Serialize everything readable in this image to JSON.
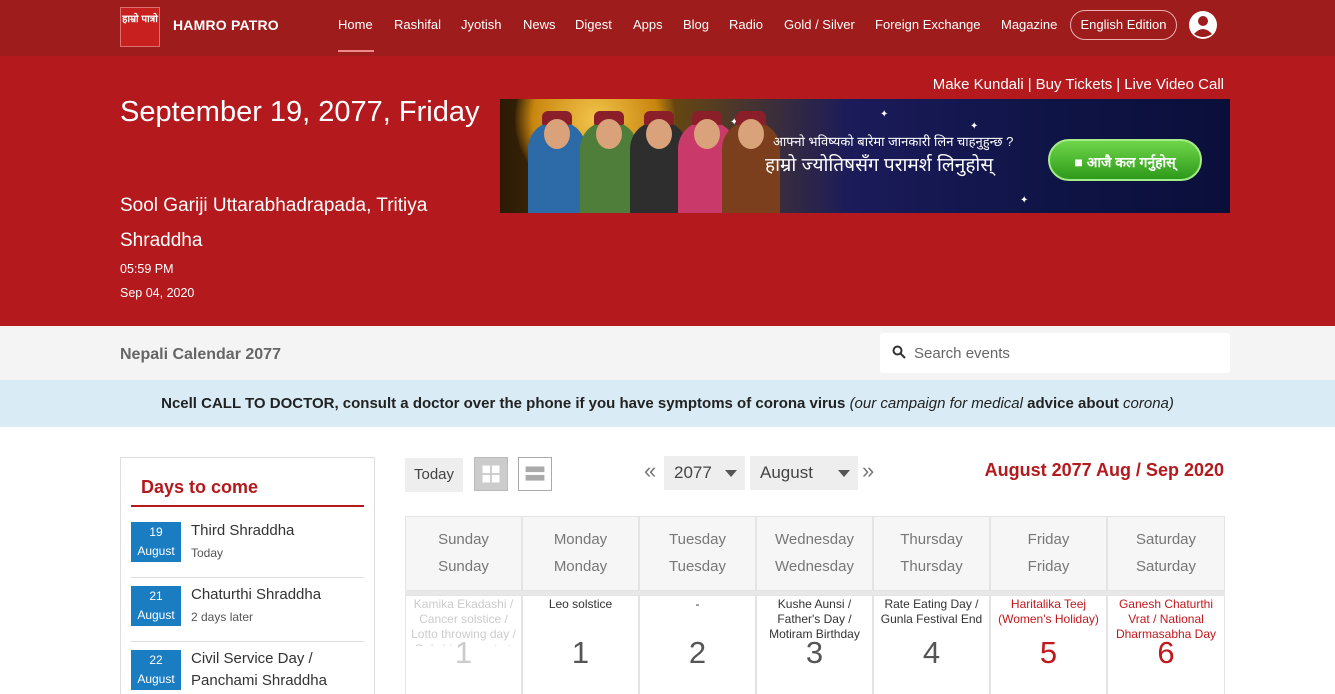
{
  "nav": {
    "logo_text": "हाम्रो पात्रो",
    "brand": "HAMRO PATRO",
    "items": [
      "Home",
      "Rashifal",
      "Jyotish",
      "News",
      "Digest",
      "Apps",
      "Blog",
      "Radio",
      "Gold / Silver",
      "Foreign Exchange",
      "Magazine"
    ],
    "edition": "English Edition"
  },
  "hero": {
    "date": "September 19, 2077, Friday",
    "tithi": "Sool Gariji Uttarabhadrapada, Tritiya Shraddha",
    "time": "05:59 PM",
    "english_date": "Sep 04, 2020",
    "links": [
      "Make Kundali",
      "Buy Tickets",
      "Live Video Call"
    ],
    "banner": {
      "line1": "आफ्नो भविष्यको बारेमा जानकारी लिन चाहनुहुन्छ ?",
      "line2": "हाम्रो ज्योतिषसँग परामर्श लिनुहोस्",
      "button": "आजै कल गर्नुहोस्"
    }
  },
  "subbar": {
    "title": "Nepali Calendar 2077",
    "search_placeholder": "Search events"
  },
  "notice": {
    "bold1": "Ncell CALL TO DOCTOR, consult a doctor over the phone if you have symptoms of corona virus",
    "italic1": "(our campaign for medical",
    "bold2": "advice about",
    "italic2": "corona)"
  },
  "sidebar": {
    "title": "Days to come",
    "events": [
      {
        "day": "19",
        "month": "August",
        "title": "Third Shraddha",
        "sub": "Today"
      },
      {
        "day": "21",
        "month": "August",
        "title": "Chaturthi Shraddha",
        "sub": "2 days later"
      },
      {
        "day": "22",
        "month": "August",
        "title": "Civil Service Day / Panchami Shraddha",
        "sub": ""
      }
    ]
  },
  "calendar": {
    "today_label": "Today",
    "year": "2077",
    "month": "August",
    "title": "August 2077 Aug / Sep 2020",
    "weekdays": [
      {
        "a": "Sunday",
        "b": "Sunday"
      },
      {
        "a": "Monday",
        "b": "Monday"
      },
      {
        "a": "Tuesday",
        "b": "Tuesday"
      },
      {
        "a": "Wednesday",
        "b": "Wednesday"
      },
      {
        "a": "Thursday",
        "b": "Thursday"
      },
      {
        "a": "Friday",
        "b": "Friday"
      },
      {
        "a": "Saturday",
        "b": "Saturday"
      }
    ],
    "days": [
      {
        "num": "1",
        "event": "Kamika Ekadashi / Cancer solstice / Lotto throwing day / Dakshinayan start",
        "state": "muted"
      },
      {
        "num": "1",
        "event": "Leo solstice",
        "state": ""
      },
      {
        "num": "2",
        "event": "-",
        "state": ""
      },
      {
        "num": "3",
        "event": "Kushe Aunsi / Father's Day / Motiram Birthday",
        "state": ""
      },
      {
        "num": "4",
        "event": "Rate Eating Day / Gunla Festival End",
        "state": ""
      },
      {
        "num": "5",
        "event": "Haritalika Teej (Women's Holiday)",
        "state": "holiday"
      },
      {
        "num": "6",
        "event": "Ganesh Chaturthi Vrat / National Dharmasabha Day",
        "state": "holiday"
      }
    ]
  },
  "colors": {
    "primary": "#b3191d",
    "nav": "#9e1c1c",
    "badge": "#1a7cc1",
    "notice_bg": "#d9ecf6"
  }
}
